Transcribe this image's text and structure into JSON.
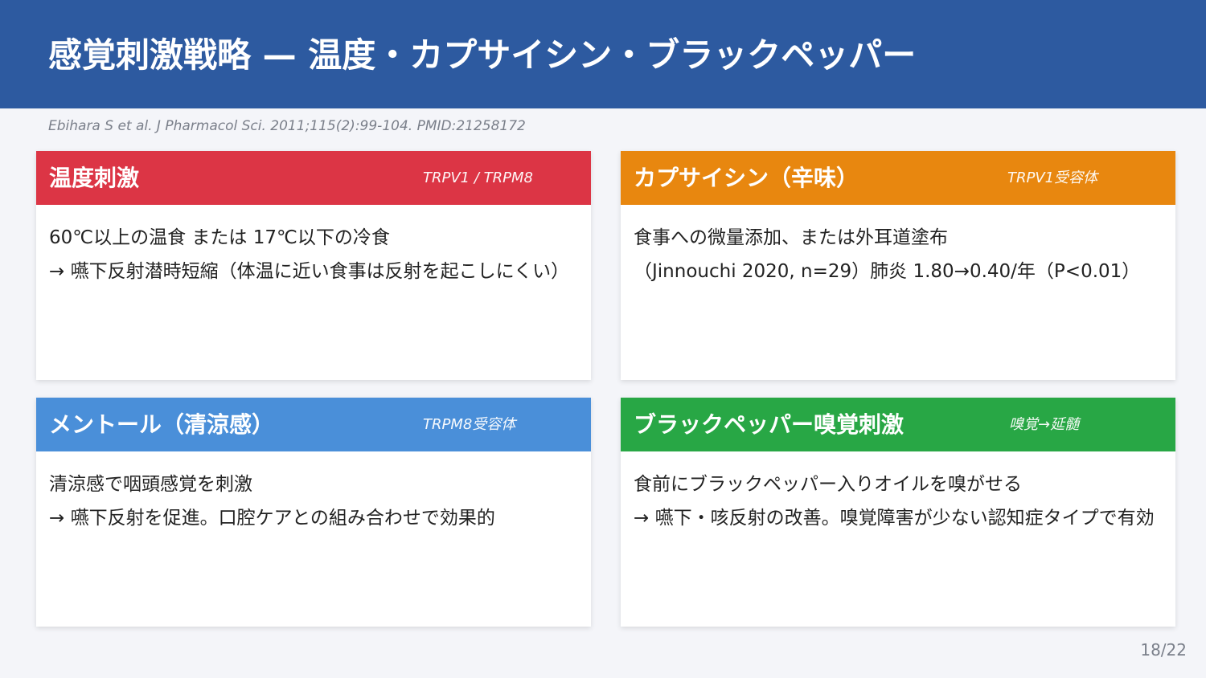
{
  "header": {
    "title": "感覚刺激戦略 — 温度・カプサイシン・ブラックペッパー",
    "color": "#2d5aa0"
  },
  "citation": "Ebihara S et al. J Pharmacol Sci. 2011;115(2):99-104.  PMID:21258172",
  "cards": [
    {
      "title": "温度刺激",
      "tag": "TRPV1 / TRPM8",
      "color": "#dc3545",
      "lines": [
        "60℃以上の温食 または 17℃以下の冷食",
        "→ 嚥下反射潜時短縮（体温に近い食事は反射を起こしにくい）"
      ]
    },
    {
      "title": "カプサイシン（辛味）",
      "tag": "TRPV1受容体",
      "color": "#e8870f",
      "lines": [
        "食事への微量添加、または外耳道塗布",
        "（Jinnouchi 2020, n=29）肺炎 1.80→0.40/年（P<0.01）"
      ]
    },
    {
      "title": "メントール（清涼感）",
      "tag": "TRPM8受容体",
      "color": "#4a8fd9",
      "lines": [
        "清涼感で咽頭感覚を刺激",
        "→ 嚥下反射を促進。口腔ケアとの組み合わせで効果的"
      ]
    },
    {
      "title": "ブラックペッパー嗅覚刺激",
      "tag": "嗅覚→延髄",
      "color": "#28a745",
      "lines": [
        "食前にブラックペッパー入りオイルを嗅がせる",
        "→ 嚥下・咳反射の改善。嗅覚障害が少ない認知症タイプで有効"
      ]
    }
  ],
  "page_number": "18/22"
}
